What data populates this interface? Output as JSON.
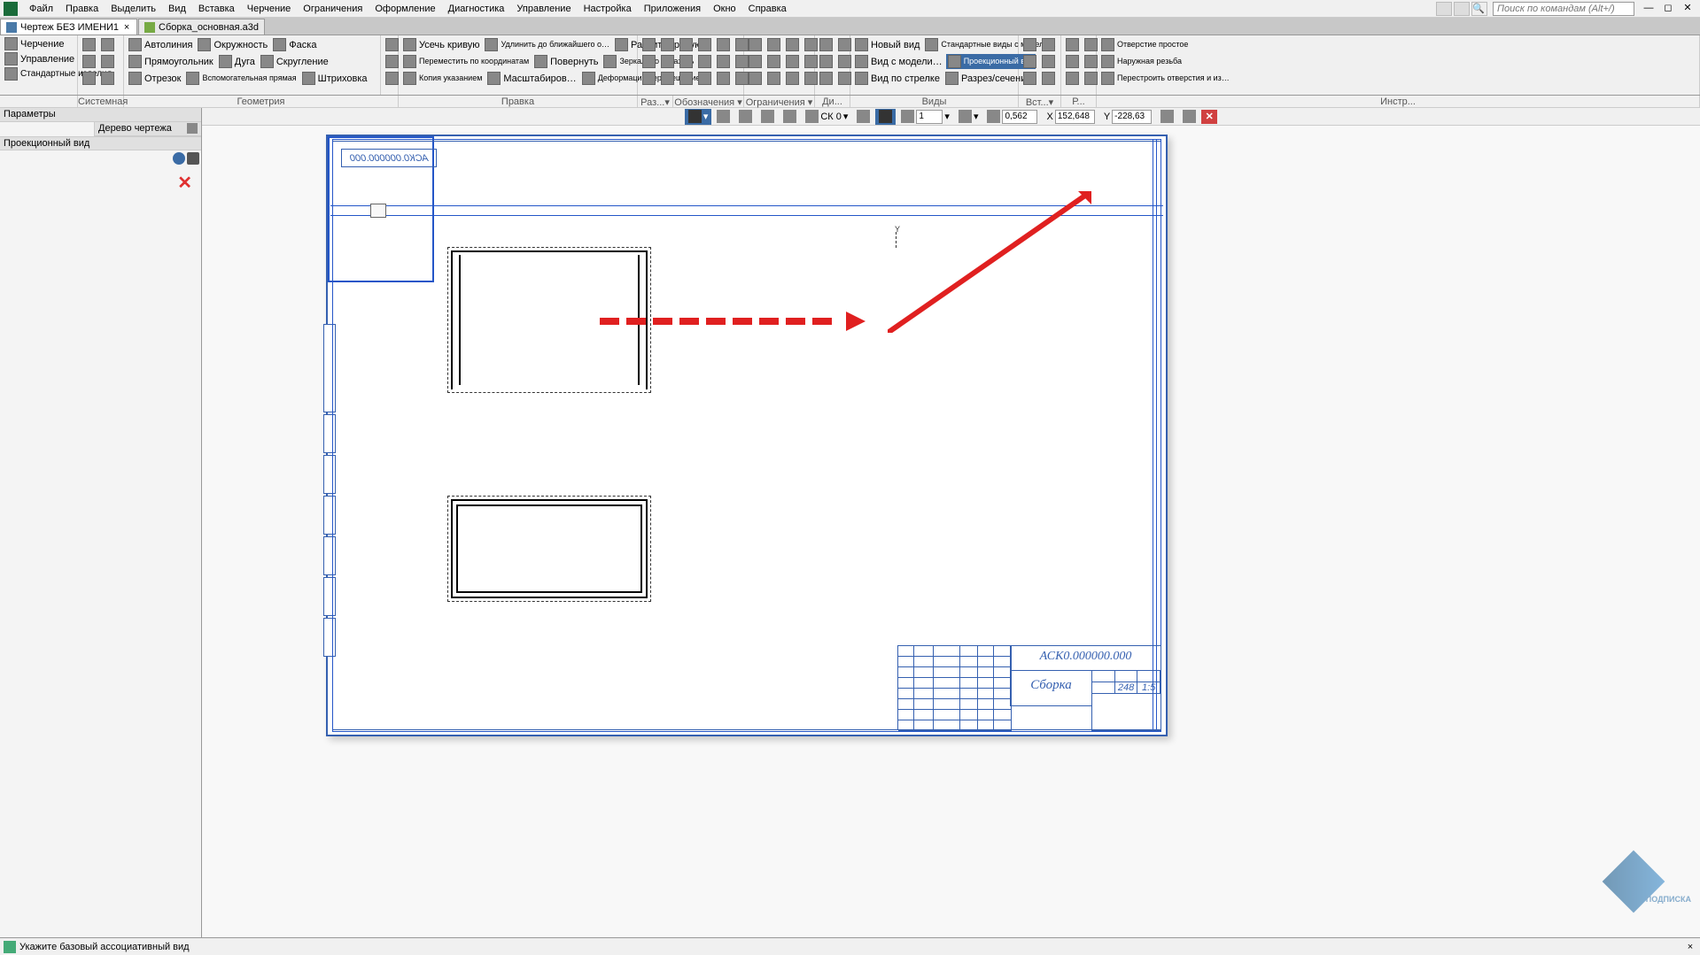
{
  "menu": {
    "items": [
      "Файл",
      "Правка",
      "Выделить",
      "Вид",
      "Вставка",
      "Черчение",
      "Ограничения",
      "Оформление",
      "Диагностика",
      "Управление",
      "Настройка",
      "Приложения",
      "Окно",
      "Справка"
    ],
    "search_placeholder": "Поиск по командам (Alt+/)"
  },
  "tabs": [
    {
      "label": "Чертеж БЕЗ ИМЕНИ1",
      "active": true
    },
    {
      "label": "Сборка_основная.a3d",
      "active": false
    }
  ],
  "ribbon": {
    "mode": "Черчение",
    "mgmt": "Управление",
    "std": "Стандартные изделия",
    "groups": {
      "sys": "Системная",
      "geom": "Геометрия",
      "edit": "Правка",
      "raz": "Раз...▾",
      "dims": "Обозначения ▾",
      "constr": "Ограничения ▾",
      "diag": "Ди...",
      "views": "Виды",
      "vst": "Вст...▾",
      "r": "Р...",
      "instr": "Инстр..."
    },
    "geom": {
      "autoline": "Автолиния",
      "circle": "Окружность",
      "chamfer": "Фаска",
      "rect": "Прямоугольник",
      "arc": "Дуга",
      "fillet": "Скругление",
      "seg": "Отрезок",
      "aux": "Вспомогательная прямая",
      "hatch": "Штриховка"
    },
    "edit": {
      "trim": "Усечь кривую",
      "extend": "Удлинить до ближайшего о…",
      "break": "Разбить кривую",
      "move": "Переместить по координатам",
      "rotate": "Повернуть",
      "mirror": "Зеркально отразить",
      "copy": "Копия указанием",
      "scale": "Масштабиров…",
      "deform": "Деформация перемещением"
    },
    "views": {
      "new": "Новый вид",
      "std": "Стандартные виды с модели…",
      "proj": "Проекционный вид",
      "model": "Вид с модели…",
      "arrow": "Вид по стрелке",
      "section": "Разрез/сечение"
    },
    "holes": {
      "simple": "Отверстие простое",
      "ext": "Наружная резьба",
      "rebuild": "Перестроить отверстия и из…"
    }
  },
  "leftpanel": {
    "params": "Параметры",
    "tree": "Дерево чертежа",
    "mode": "Проекционный вид"
  },
  "contextbar": {
    "cs": "СК 0",
    "scale_val": "1",
    "zoom": "0,562",
    "x_label": "X",
    "x": "152,648",
    "y_label": "Y",
    "y": "-228,63"
  },
  "sheet": {
    "label": "АСК0.000000.000",
    "axis_y": "Y"
  },
  "titleblock": {
    "code": "АСК0.000000.000",
    "name": "Сборка",
    "mass": "248",
    "scale": "1:5"
  },
  "statusbar": {
    "msg": "Укажите базовый ассоциативный вид"
  },
  "watermark": {
    "txt": "ПОДПИСКА"
  }
}
